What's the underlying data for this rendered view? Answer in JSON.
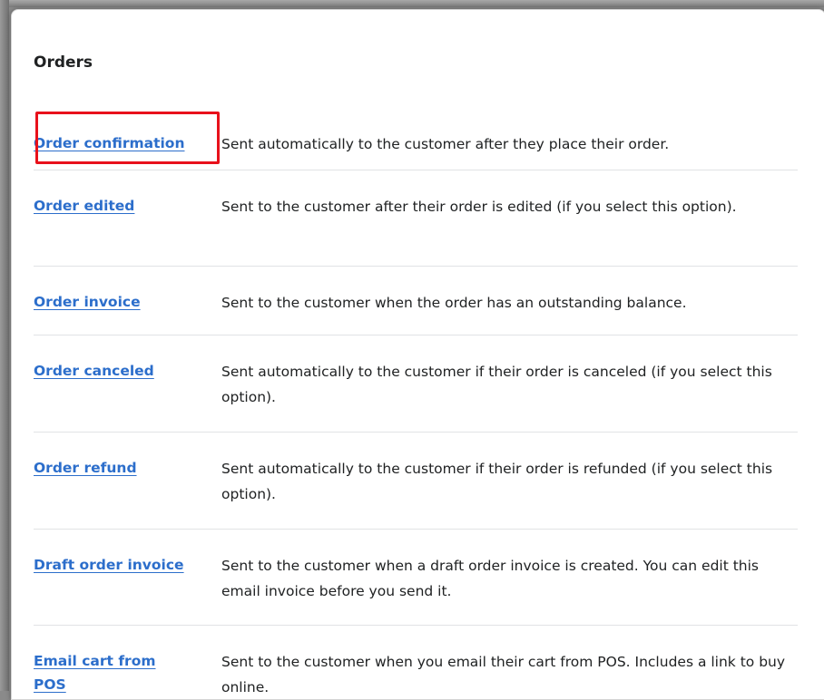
{
  "section": {
    "title": "Orders"
  },
  "notifications": [
    {
      "label": "Order confirmation",
      "description": "Sent automatically to the customer after they place their order."
    },
    {
      "label": "Order edited",
      "description": "Sent to the customer after their order is edited (if you select this option)."
    },
    {
      "label": "Order invoice",
      "description": "Sent to the customer when the order has an outstanding balance."
    },
    {
      "label": "Order canceled",
      "description": "Sent automatically to the customer if their order is canceled (if you select this option)."
    },
    {
      "label": "Order refund",
      "description": "Sent automatically to the customer if their order is refunded (if you select this option)."
    },
    {
      "label": "Draft order invoice",
      "description": "Sent to the customer when a draft order invoice is created. You can edit this email invoice before you send it."
    },
    {
      "label": "Email cart from POS",
      "description": "Sent to the customer when you email their cart from POS. Includes a link to buy online."
    }
  ],
  "colors": {
    "link": "#2c6ecb",
    "highlight": "#e8111b",
    "text": "#202223",
    "divider": "#e1e3e5"
  }
}
